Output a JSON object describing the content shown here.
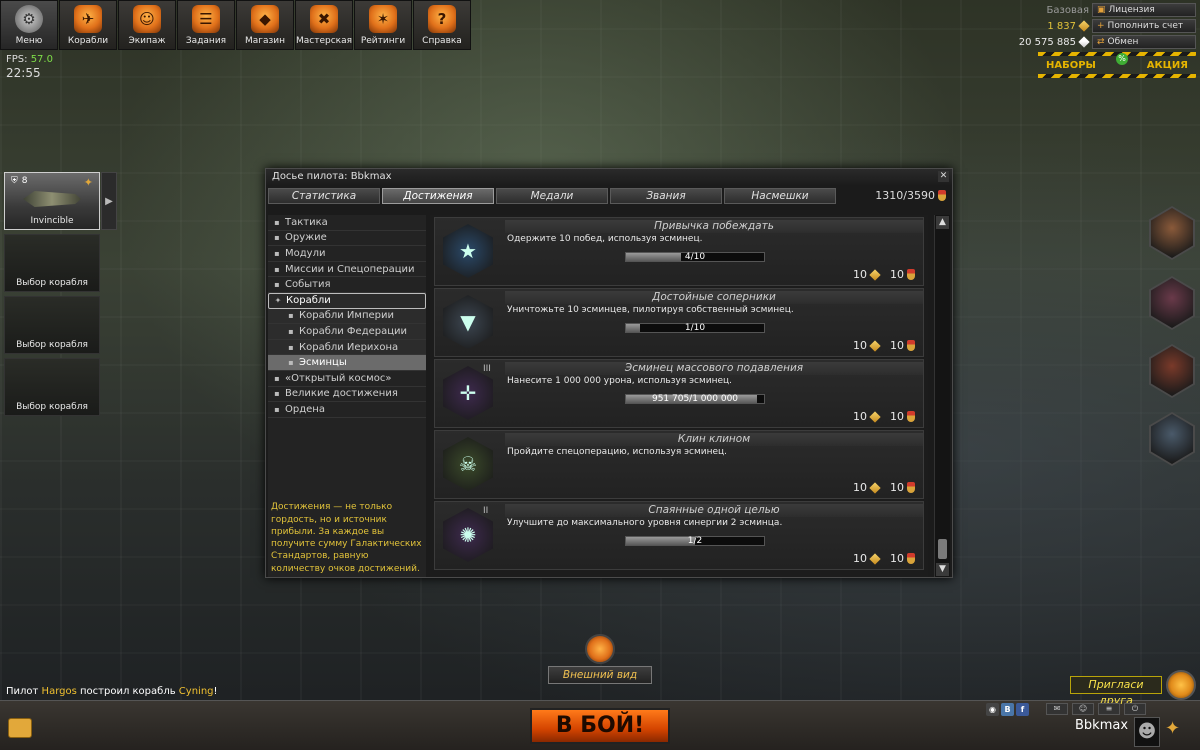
{
  "nav": [
    {
      "label": "Меню",
      "icon": "gear-icon",
      "glyph": "⚙"
    },
    {
      "label": "Корабли",
      "icon": "ships-icon",
      "glyph": "✈"
    },
    {
      "label": "Экипаж",
      "icon": "crew-icon",
      "glyph": "☺"
    },
    {
      "label": "Задания",
      "icon": "tasks-icon",
      "glyph": "☰"
    },
    {
      "label": "Магазин",
      "icon": "shop-icon",
      "glyph": "◆"
    },
    {
      "label": "Мастерская",
      "icon": "workshop-icon",
      "glyph": "✖"
    },
    {
      "label": "Рейтинги",
      "icon": "ratings-icon",
      "glyph": "✶"
    },
    {
      "label": "Справка",
      "icon": "help-icon",
      "glyph": "?"
    }
  ],
  "hud": {
    "fps_label": "FPS:",
    "fps_value": "57.0",
    "time": "22:55"
  },
  "account": {
    "base_label": "Базовая",
    "license_btn": "Лицензия",
    "credits": "1 837",
    "topup_btn": "Пополнить счет",
    "money": "20 575 885",
    "exchange_btn": "Обмен",
    "sets_label": "НАБОРЫ",
    "promo_label": "АКЦИЯ",
    "badge": "%"
  },
  "slots": [
    {
      "label": "Invincible",
      "rank": "8",
      "active": true
    },
    {
      "label": "Выбор корабля"
    },
    {
      "label": "Выбор корабля"
    },
    {
      "label": "Выбор корабля"
    }
  ],
  "dialog": {
    "title": "Досье пилота: Bbkmax",
    "tabs": [
      "Статистика",
      "Достижения",
      "Медали",
      "Звания",
      "Насмешки"
    ],
    "active_tab": 1,
    "score": "1310/3590",
    "categories": [
      {
        "label": "Тактика",
        "icon": "tactics-icon"
      },
      {
        "label": "Оружие",
        "icon": "weapon-icon"
      },
      {
        "label": "Модули",
        "icon": "modules-icon"
      },
      {
        "label": "Миссии и Спецоперации",
        "icon": "missions-icon"
      },
      {
        "label": "События",
        "icon": "events-icon"
      },
      {
        "label": "Корабли",
        "icon": "ships-cat-icon",
        "open": true
      },
      {
        "label": "Корабли Империи",
        "icon": "empire-icon",
        "sub": true
      },
      {
        "label": "Корабли Федерации",
        "icon": "federation-icon",
        "sub": true
      },
      {
        "label": "Корабли Иерихона",
        "icon": "jericho-icon",
        "sub": true
      },
      {
        "label": "Эсминцы",
        "icon": "destroyer-icon",
        "sub": true,
        "selected": true
      },
      {
        "label": "«Открытый космос»",
        "icon": "open-space-icon"
      },
      {
        "label": "Великие достижения",
        "icon": "great-icon"
      },
      {
        "label": "Ордена",
        "icon": "orders-icon"
      }
    ],
    "hint": "Достижения — не только гордость, но и источник прибыли. За каждое вы получите сумму Галактических Стандартов, равную количеству очков достижений.",
    "achievements": [
      {
        "title": "Привычка побеждать",
        "desc": "Одержите 10 побед, используя эсминец.",
        "progress": "4/10",
        "fraction": 0.4,
        "reward_credits": "10",
        "reward_points": "10",
        "badge_color": "#2b4a6a",
        "glyph": "★",
        "badge_icon": "star-badge-icon"
      },
      {
        "title": "Достойные соперники",
        "desc": "Уничтожьте 10 эсминцев, пилотируя собственный эсминец.",
        "progress": "1/10",
        "fraction": 0.1,
        "reward_credits": "10",
        "reward_points": "10",
        "badge_color": "#3d4752",
        "glyph": "▼",
        "badge_icon": "shield-badge-icon"
      },
      {
        "title": "Эсминец массового подавления",
        "desc": "Нанесите 1 000 000 урона, используя эсминец.",
        "progress": "951 705/1 000 000",
        "fraction": 0.95,
        "reward_credits": "10",
        "reward_points": "10",
        "badge_color": "#3e2a4e",
        "glyph": "✛",
        "badge_icon": "crosshair-badge-icon",
        "locked": "III"
      },
      {
        "title": "Клин клином",
        "desc": "Пройдите спецоперацию, используя эсминец.",
        "progress": "",
        "fraction": 0,
        "reward_credits": "10",
        "reward_points": "10",
        "badge_color": "#3b4a2a",
        "glyph": "☠",
        "badge_icon": "skull-badge-icon"
      },
      {
        "title": "Спаянные одной целью",
        "desc": "Улучшите до максимального уровня синергии 2 эсминца.",
        "progress": "1/2",
        "fraction": 0.5,
        "reward_credits": "10",
        "reward_points": "10",
        "badge_color": "#3e2a4e",
        "glyph": "✺",
        "badge_icon": "gear-badge-icon",
        "locked": "II"
      }
    ]
  },
  "bottom": {
    "exterior_btn": "Внешний вид",
    "chat_prefix": "Пилот",
    "chat_player": "Hargos",
    "chat_middle": "построил корабль",
    "chat_ship": "Cyning",
    "chat_suffix": "!",
    "fight_btn": "В БОЙ!",
    "invite_btn": "Пригласи друга",
    "username": "Bbkmax"
  },
  "avatars": [
    {
      "name": "pilot-avatar-1",
      "color": "#8a5a3a"
    },
    {
      "name": "pilot-avatar-2",
      "color": "#6a3a4a"
    },
    {
      "name": "pilot-avatar-3",
      "color": "#7a3a2a"
    },
    {
      "name": "pilot-avatar-4",
      "color": "#4a5a6a"
    }
  ],
  "colors": {
    "accent": "#e0701a",
    "gold": "#e2c33a",
    "hazard": "#e6b400"
  }
}
